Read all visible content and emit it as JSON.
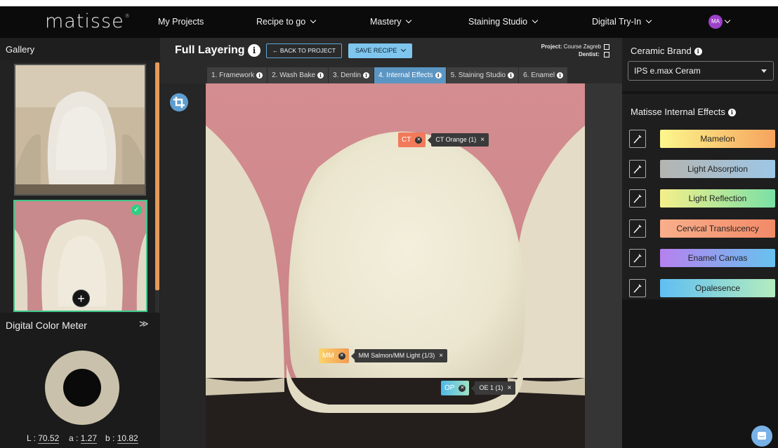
{
  "brand": {
    "logo": "matisse",
    "trademark": "®"
  },
  "nav": {
    "items": [
      {
        "label": "My Projects",
        "dropdown": false
      },
      {
        "label": "Recipe to go",
        "dropdown": true
      },
      {
        "label": "Mastery",
        "dropdown": true
      },
      {
        "label": "Staining Studio",
        "dropdown": true
      },
      {
        "label": "Digital Try-In",
        "dropdown": true
      }
    ],
    "avatar_initials": "MA"
  },
  "gallery": {
    "title": "Gallery",
    "add_label": "+",
    "selected_index": 1
  },
  "color_meter": {
    "title": "Digital Color Meter",
    "toggle": "≫",
    "swatch_color": "#c9c1ab",
    "L_label": "L :",
    "L": "70.52",
    "a_label": "a :",
    "a": "1.27",
    "b_label": "b :",
    "b": "10.82"
  },
  "header": {
    "title": "Full Layering",
    "info": "i",
    "back_label": "← BACK TO PROJECT",
    "save_label": "SAVE RECIPE",
    "project_label": "Project:",
    "project_value": "Course Zagreb",
    "dentist_label": "Dentist:",
    "dentist_value": ""
  },
  "tabs": [
    {
      "label": "1. Framework",
      "active": false
    },
    {
      "label": "2. Wash Bake",
      "active": false
    },
    {
      "label": "3. Dentin",
      "active": false
    },
    {
      "label": "4. Internal Effects",
      "active": true
    },
    {
      "label": "5. Staining Studio",
      "active": false
    },
    {
      "label": "6. Enamel",
      "active": false
    }
  ],
  "tags": [
    {
      "code": "CT",
      "label": "CT Orange (1)",
      "close": "×",
      "color": "#f07a5a"
    },
    {
      "code": "MM",
      "label": "MM Salmon/MM Light (1/3)",
      "close": "×",
      "color": "#f5a84e"
    },
    {
      "code": "OP",
      "label": "OE 1 (1)",
      "close": "×",
      "color": "#4fb8e8"
    }
  ],
  "ceramic": {
    "title": "Ceramic Brand",
    "info": "i",
    "selected": "IPS e.max Ceram"
  },
  "effects": {
    "title": "Matisse Internal Effects",
    "info": "i",
    "items": [
      {
        "label": "Mamelon",
        "gradient": [
          "#fcf78c",
          "#f6a35e"
        ]
      },
      {
        "label": "Light Absorption",
        "gradient": [
          "#b4b4b0",
          "#9dc7e6"
        ]
      },
      {
        "label": "Light Reflection",
        "gradient": [
          "#f5ef8a",
          "#7ae0a6"
        ]
      },
      {
        "label": "Cervical Translucency",
        "gradient": [
          "#f9ae8a",
          "#f28a68"
        ]
      },
      {
        "label": "Enamel Canvas",
        "gradient": [
          "#b681ef",
          "#67c2ee"
        ]
      },
      {
        "label": "Opalesence",
        "gradient": [
          "#5fbff2",
          "#b4ecbe"
        ]
      }
    ]
  },
  "colors": {
    "accent_blue": "#5b96c3",
    "gallery_scroll": "#e39a5a",
    "selected_border": "#3cc98a",
    "avatar": "#9c42c8"
  }
}
